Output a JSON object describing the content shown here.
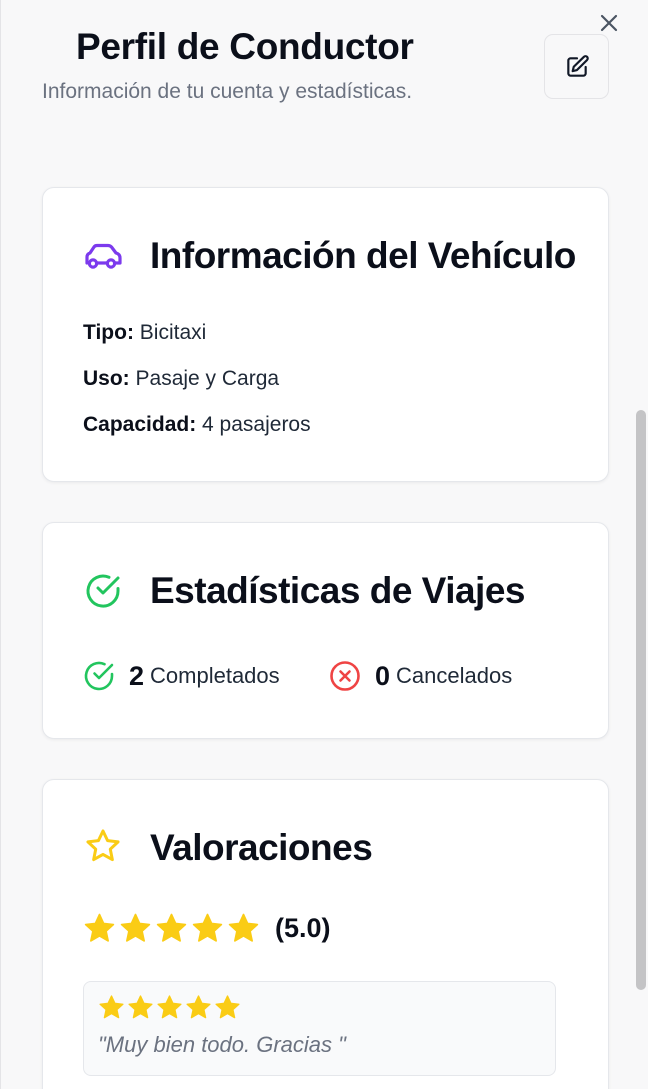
{
  "header": {
    "title": "Perfil de Conductor",
    "subtitle": "Información de tu cuenta y estadísticas."
  },
  "icons": {
    "close": "close-icon",
    "edit": "pencil-square-icon",
    "vehicle": "car-icon",
    "stats": "check-circle-icon",
    "ratings": "star-outline-icon"
  },
  "vehicle_card": {
    "title": "Información del Vehículo",
    "rows": [
      {
        "label": "Tipo:",
        "value": "Bicitaxi"
      },
      {
        "label": "Uso:",
        "value": "Pasaje y Carga"
      },
      {
        "label": "Capacidad:",
        "value": "4 pasajeros"
      }
    ]
  },
  "stats_card": {
    "title": "Estadísticas de Viajes",
    "completed": {
      "count": "2",
      "label": "Completados"
    },
    "cancelled": {
      "count": "0",
      "label": "Cancelados"
    }
  },
  "ratings_card": {
    "title": "Valoraciones",
    "stars": 5,
    "average": "(5.0)",
    "reviews": [
      {
        "stars": 5,
        "text": "\"Muy bien todo. Gracias \""
      }
    ]
  },
  "colors": {
    "accent_purple": "#7c3aed",
    "success_green": "#22c55e",
    "danger_red": "#ef4444",
    "star_yellow": "#facc15"
  }
}
